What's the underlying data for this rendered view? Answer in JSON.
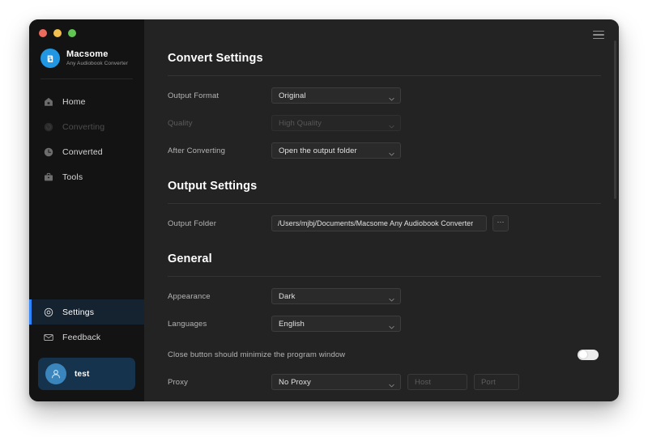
{
  "window": {
    "traffic_lights": [
      "close",
      "minimize",
      "maximize"
    ],
    "menu_icon": "hamburger-icon"
  },
  "brand": {
    "name": "Macsome",
    "subtitle": "Any Audiobook Converter",
    "logo_icon": "macsome-logo-icon",
    "logo_color": "#2196e3"
  },
  "sidebar": {
    "items": [
      {
        "label": "Home",
        "icon": "home-icon",
        "state": "normal"
      },
      {
        "label": "Converting",
        "icon": "converting-icon",
        "state": "disabled"
      },
      {
        "label": "Converted",
        "icon": "converted-clock-icon",
        "state": "normal"
      },
      {
        "label": "Tools",
        "icon": "tools-briefcase-icon",
        "state": "normal"
      }
    ],
    "bottom_items": [
      {
        "label": "Settings",
        "icon": "gear-icon",
        "state": "active"
      },
      {
        "label": "Feedback",
        "icon": "envelope-icon",
        "state": "normal"
      }
    ],
    "user": {
      "name": "test",
      "avatar_icon": "user-avatar-icon"
    },
    "active_accent_color": "#2f87ff"
  },
  "main": {
    "sections": [
      {
        "title": "Convert Settings",
        "rows": [
          {
            "label": "Output Format",
            "control": "select",
            "value": "Original",
            "disabled": false
          },
          {
            "label": "Quality",
            "control": "select",
            "value": "High Quality",
            "disabled": true
          },
          {
            "label": "After Converting",
            "control": "select",
            "value": "Open the output folder",
            "disabled": false
          }
        ]
      },
      {
        "title": "Output Settings",
        "rows": [
          {
            "label": "Output Folder",
            "control": "path",
            "value": "/Users/mjbj/Documents/Macsome Any Audiobook Converter",
            "browse_label": "···"
          }
        ]
      },
      {
        "title": "General",
        "rows": [
          {
            "label": "Appearance",
            "control": "select",
            "value": "Dark",
            "disabled": false
          },
          {
            "label": "Languages",
            "control": "select",
            "value": "English",
            "disabled": false
          },
          {
            "label": "Close button should minimize the program window",
            "control": "toggle",
            "value": "off"
          },
          {
            "label": "Proxy",
            "control": "select",
            "value": "No Proxy",
            "disabled": false
          }
        ]
      }
    ],
    "proxy": {
      "host_placeholder": "Host",
      "host_value": "",
      "port_placeholder": "Port",
      "port_value": ""
    }
  }
}
